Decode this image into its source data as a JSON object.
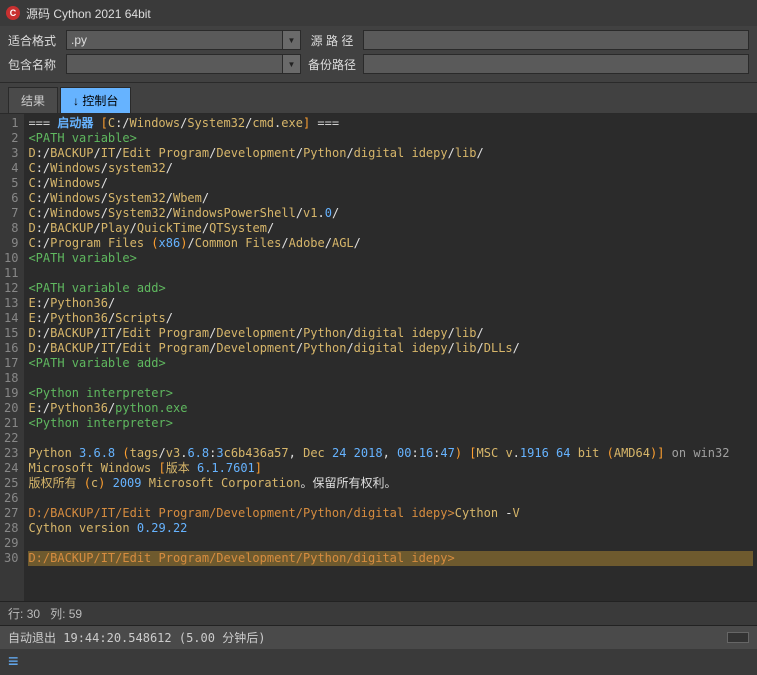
{
  "title": "源码 Cython 2021 64bit",
  "toolbar": {
    "format_label": "适合格式",
    "format_value": ".py",
    "path_label": "源 路 径",
    "name_label": "包含名称",
    "name_value": "",
    "backup_label": "备份路径"
  },
  "tabs": {
    "results": "结果",
    "console": "↓ 控制台"
  },
  "lines": [
    {
      "n": 1,
      "seg": [
        [
          "k-eq",
          "=== "
        ],
        [
          "k-bold",
          "启动器 "
        ],
        [
          "k-bracket",
          "["
        ],
        [
          "k-yellow",
          "C"
        ],
        [
          "k-white",
          ":/"
        ],
        [
          "k-yellow",
          "Windows"
        ],
        [
          "k-white",
          "/"
        ],
        [
          "k-yellow",
          "System32"
        ],
        [
          "k-white",
          "/"
        ],
        [
          "k-yellow",
          "cmd"
        ],
        [
          "k-white",
          "."
        ],
        [
          "k-yellow",
          "exe"
        ],
        [
          "k-bracket",
          "]"
        ],
        [
          "k-eq",
          " ==="
        ]
      ]
    },
    {
      "n": 2,
      "seg": [
        [
          "k-green",
          "<PATH variable>"
        ]
      ]
    },
    {
      "n": 3,
      "seg": [
        [
          "k-yellow",
          "D"
        ],
        [
          "k-white",
          ":/"
        ],
        [
          "k-yellow",
          "BACKUP"
        ],
        [
          "k-white",
          "/"
        ],
        [
          "k-yellow",
          "IT"
        ],
        [
          "k-white",
          "/"
        ],
        [
          "k-yellow",
          "Edit Program"
        ],
        [
          "k-white",
          "/"
        ],
        [
          "k-yellow",
          "Development"
        ],
        [
          "k-white",
          "/"
        ],
        [
          "k-yellow",
          "Python"
        ],
        [
          "k-white",
          "/"
        ],
        [
          "k-yellow",
          "digital idepy"
        ],
        [
          "k-white",
          "/"
        ],
        [
          "k-yellow",
          "lib"
        ],
        [
          "k-white",
          "/"
        ]
      ]
    },
    {
      "n": 4,
      "seg": [
        [
          "k-yellow",
          "C"
        ],
        [
          "k-white",
          ":/"
        ],
        [
          "k-yellow",
          "Windows"
        ],
        [
          "k-white",
          "/"
        ],
        [
          "k-yellow",
          "system32"
        ],
        [
          "k-white",
          "/"
        ]
      ]
    },
    {
      "n": 5,
      "seg": [
        [
          "k-yellow",
          "C"
        ],
        [
          "k-white",
          ":/"
        ],
        [
          "k-yellow",
          "Windows"
        ],
        [
          "k-white",
          "/"
        ]
      ]
    },
    {
      "n": 6,
      "seg": [
        [
          "k-yellow",
          "C"
        ],
        [
          "k-white",
          ":/"
        ],
        [
          "k-yellow",
          "Windows"
        ],
        [
          "k-white",
          "/"
        ],
        [
          "k-yellow",
          "System32"
        ],
        [
          "k-white",
          "/"
        ],
        [
          "k-yellow",
          "Wbem"
        ],
        [
          "k-white",
          "/"
        ]
      ]
    },
    {
      "n": 7,
      "seg": [
        [
          "k-yellow",
          "C"
        ],
        [
          "k-white",
          ":/"
        ],
        [
          "k-yellow",
          "Windows"
        ],
        [
          "k-white",
          "/"
        ],
        [
          "k-yellow",
          "System32"
        ],
        [
          "k-white",
          "/"
        ],
        [
          "k-yellow",
          "WindowsPowerShell"
        ],
        [
          "k-white",
          "/"
        ],
        [
          "k-yellow",
          "v1"
        ],
        [
          "k-white",
          "."
        ],
        [
          "k-num",
          "0"
        ],
        [
          "k-white",
          "/"
        ]
      ]
    },
    {
      "n": 8,
      "seg": [
        [
          "k-yellow",
          "D"
        ],
        [
          "k-white",
          ":/"
        ],
        [
          "k-yellow",
          "BACKUP"
        ],
        [
          "k-white",
          "/"
        ],
        [
          "k-yellow",
          "Play"
        ],
        [
          "k-white",
          "/"
        ],
        [
          "k-yellow",
          "QuickTime"
        ],
        [
          "k-white",
          "/"
        ],
        [
          "k-yellow",
          "QTSystem"
        ],
        [
          "k-white",
          "/"
        ]
      ]
    },
    {
      "n": 9,
      "seg": [
        [
          "k-yellow",
          "C"
        ],
        [
          "k-white",
          ":/"
        ],
        [
          "k-yellow",
          "Program Files "
        ],
        [
          "k-bracket",
          "("
        ],
        [
          "k-num",
          "x86"
        ],
        [
          "k-bracket",
          ")"
        ],
        [
          "k-white",
          "/"
        ],
        [
          "k-yellow",
          "Common Files"
        ],
        [
          "k-white",
          "/"
        ],
        [
          "k-yellow",
          "Adobe"
        ],
        [
          "k-white",
          "/"
        ],
        [
          "k-yellow",
          "AGL"
        ],
        [
          "k-white",
          "/"
        ]
      ]
    },
    {
      "n": 10,
      "seg": [
        [
          "k-green",
          "<PATH variable>"
        ]
      ]
    },
    {
      "n": 11,
      "seg": [
        [
          "",
          ""
        ]
      ]
    },
    {
      "n": 12,
      "seg": [
        [
          "k-green",
          "<PATH variable add>"
        ]
      ]
    },
    {
      "n": 13,
      "seg": [
        [
          "k-yellow",
          "E"
        ],
        [
          "k-white",
          ":/"
        ],
        [
          "k-yellow",
          "Python36"
        ],
        [
          "k-white",
          "/"
        ]
      ]
    },
    {
      "n": 14,
      "seg": [
        [
          "k-yellow",
          "E"
        ],
        [
          "k-white",
          ":/"
        ],
        [
          "k-yellow",
          "Python36"
        ],
        [
          "k-white",
          "/"
        ],
        [
          "k-yellow",
          "Scripts"
        ],
        [
          "k-white",
          "/"
        ]
      ]
    },
    {
      "n": 15,
      "seg": [
        [
          "k-yellow",
          "D"
        ],
        [
          "k-white",
          ":/"
        ],
        [
          "k-yellow",
          "BACKUP"
        ],
        [
          "k-white",
          "/"
        ],
        [
          "k-yellow",
          "IT"
        ],
        [
          "k-white",
          "/"
        ],
        [
          "k-yellow",
          "Edit Program"
        ],
        [
          "k-white",
          "/"
        ],
        [
          "k-yellow",
          "Development"
        ],
        [
          "k-white",
          "/"
        ],
        [
          "k-yellow",
          "Python"
        ],
        [
          "k-white",
          "/"
        ],
        [
          "k-yellow",
          "digital idepy"
        ],
        [
          "k-white",
          "/"
        ],
        [
          "k-yellow",
          "lib"
        ],
        [
          "k-white",
          "/"
        ]
      ]
    },
    {
      "n": 16,
      "seg": [
        [
          "k-yellow",
          "D"
        ],
        [
          "k-white",
          ":/"
        ],
        [
          "k-yellow",
          "BACKUP"
        ],
        [
          "k-white",
          "/"
        ],
        [
          "k-yellow",
          "IT"
        ],
        [
          "k-white",
          "/"
        ],
        [
          "k-yellow",
          "Edit Program"
        ],
        [
          "k-white",
          "/"
        ],
        [
          "k-yellow",
          "Development"
        ],
        [
          "k-white",
          "/"
        ],
        [
          "k-yellow",
          "Python"
        ],
        [
          "k-white",
          "/"
        ],
        [
          "k-yellow",
          "digital idepy"
        ],
        [
          "k-white",
          "/"
        ],
        [
          "k-yellow",
          "lib"
        ],
        [
          "k-white",
          "/"
        ],
        [
          "k-yellow",
          "DLLs"
        ],
        [
          "k-white",
          "/"
        ]
      ]
    },
    {
      "n": 17,
      "seg": [
        [
          "k-green",
          "<PATH variable add>"
        ]
      ]
    },
    {
      "n": 18,
      "seg": [
        [
          "",
          ""
        ]
      ]
    },
    {
      "n": 19,
      "seg": [
        [
          "k-green",
          "<Python interpreter>"
        ]
      ]
    },
    {
      "n": 20,
      "seg": [
        [
          "k-yellow",
          "E"
        ],
        [
          "k-white",
          ":/"
        ],
        [
          "k-yellow",
          "Python36"
        ],
        [
          "k-white",
          "/"
        ],
        [
          "k-green",
          "python.exe"
        ]
      ]
    },
    {
      "n": 21,
      "seg": [
        [
          "k-green",
          "<Python interpreter>"
        ]
      ]
    },
    {
      "n": 22,
      "seg": [
        [
          "",
          ""
        ]
      ]
    },
    {
      "n": 23,
      "seg": [
        [
          "k-yellow",
          "Python "
        ],
        [
          "k-num",
          "3.6.8 "
        ],
        [
          "k-bracket",
          "("
        ],
        [
          "k-yellow",
          "tags"
        ],
        [
          "k-white",
          "/"
        ],
        [
          "k-yellow",
          "v3"
        ],
        [
          "k-white",
          "."
        ],
        [
          "k-num",
          "6.8"
        ],
        [
          "k-white",
          ":"
        ],
        [
          "k-num",
          "3"
        ],
        [
          "k-yellow",
          "c6b436a57"
        ],
        [
          "k-white",
          ", "
        ],
        [
          "k-yellow",
          "Dec "
        ],
        [
          "k-num",
          "24 2018"
        ],
        [
          "k-white",
          ", "
        ],
        [
          "k-num",
          "00"
        ],
        [
          "k-white",
          ":"
        ],
        [
          "k-num",
          "16"
        ],
        [
          "k-white",
          ":"
        ],
        [
          "k-num",
          "47"
        ],
        [
          "k-bracket",
          ") ["
        ],
        [
          "k-yellow",
          "MSC v"
        ],
        [
          "k-white",
          "."
        ],
        [
          "k-num",
          "1916 64 "
        ],
        [
          "k-yellow",
          "bit "
        ],
        [
          "k-bracket",
          "("
        ],
        [
          "k-yellow",
          "AMD64"
        ],
        [
          "k-bracket",
          ")]"
        ],
        [
          "k-gray",
          " on win32"
        ]
      ]
    },
    {
      "n": 24,
      "seg": [
        [
          "k-yellow",
          "Microsoft Windows "
        ],
        [
          "k-bracket",
          "["
        ],
        [
          "k-yellow",
          "版本 "
        ],
        [
          "k-num",
          "6.1.7601"
        ],
        [
          "k-bracket",
          "]"
        ]
      ]
    },
    {
      "n": 25,
      "seg": [
        [
          "k-yellow",
          "版权所有 "
        ],
        [
          "k-bracket",
          "("
        ],
        [
          "k-yellow",
          "c"
        ],
        [
          "k-bracket",
          ") "
        ],
        [
          "k-num",
          "2009 "
        ],
        [
          "k-yellow",
          "Microsoft Corporation"
        ],
        [
          "k-white",
          "。保留所有权利。"
        ]
      ]
    },
    {
      "n": 26,
      "seg": [
        [
          "",
          ""
        ]
      ]
    },
    {
      "n": 27,
      "seg": [
        [
          "k-orange",
          "D:/BACKUP/IT/Edit Program/Development/Python/digital idepy>"
        ],
        [
          "k-yellow",
          "Cython "
        ],
        [
          "k-white",
          "-"
        ],
        [
          "k-yellow",
          "V"
        ]
      ]
    },
    {
      "n": 28,
      "seg": [
        [
          "k-yellow",
          "Cython version "
        ],
        [
          "k-num",
          "0.29.22"
        ]
      ]
    },
    {
      "n": 29,
      "seg": [
        [
          "",
          ""
        ]
      ]
    },
    {
      "n": 30,
      "hl": true,
      "seg": [
        [
          "k-orange",
          "D:/BACKUP/IT/Edit Program/Development/Python/digital idepy>"
        ]
      ]
    }
  ],
  "status": {
    "row_label": "行:",
    "row": "30",
    "col_label": "列:",
    "col": "59"
  },
  "auto": {
    "label": "自动退出",
    "time": "19:44:20.548612",
    "remain": "(5.00 分钟后)"
  }
}
